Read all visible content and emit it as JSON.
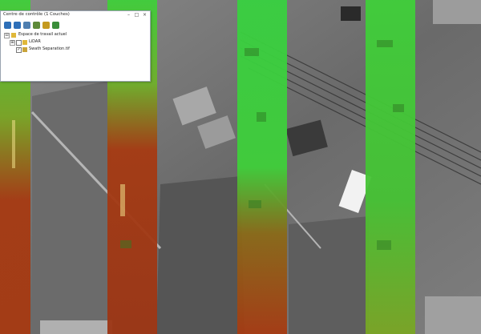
{
  "panel": {
    "title": "Centre de contrôle (1 Couches)",
    "window_controls": {
      "minimize": "–",
      "maximize": "□",
      "close": "×"
    },
    "toolbar": [
      {
        "name": "zoom-in-icon",
        "color": "#2d6fb8"
      },
      {
        "name": "zoom-out-icon",
        "color": "#2d6fb8"
      },
      {
        "name": "layer-icon",
        "color": "#4f7fb0"
      },
      {
        "name": "settings-icon",
        "color": "#5d8a3a"
      },
      {
        "name": "add-layer-icon",
        "color": "#c49a1f"
      },
      {
        "name": "refresh-icon",
        "color": "#3a8e3a"
      }
    ],
    "tree": {
      "root": {
        "expander": "⊟",
        "label": "Espace de travail actuel"
      },
      "items": [
        {
          "expander": "⊞",
          "checked": false,
          "label": "LiDAR"
        },
        {
          "expander": "",
          "checked": true,
          "label": "Swath Separation.tif"
        }
      ]
    }
  },
  "map": {
    "strips": [
      {
        "color_top": "#3fcf3a",
        "color_bottom": "#a63a12"
      },
      {
        "color_top": "#3fcf3a",
        "color_bottom": "#a63a12"
      },
      {
        "color_top": "#3fcf3a",
        "color_bottom": "#a63a12"
      },
      {
        "color_top": "#3fcf3a",
        "color_bottom": "#9c3514"
      },
      {
        "color_top": "#3fcf3a",
        "color_bottom": "#7aa524"
      }
    ]
  }
}
